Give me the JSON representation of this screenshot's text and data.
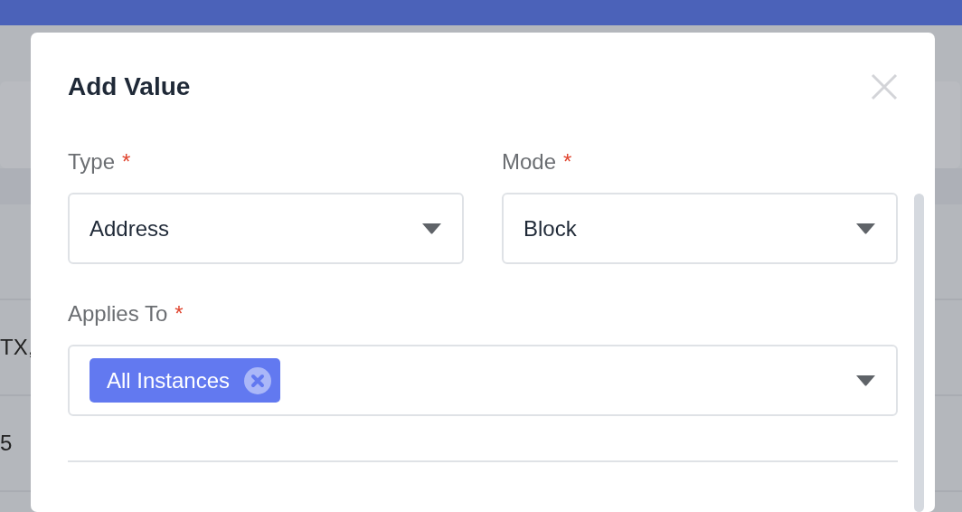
{
  "background": {
    "rows": [
      {
        "text": "TX,"
      },
      {
        "text": "5"
      }
    ]
  },
  "modal": {
    "title": "Add Value",
    "required_mark": "*",
    "fields": [
      {
        "label": "Type",
        "required": true,
        "value": "Address"
      },
      {
        "label": "Mode",
        "required": true,
        "value": "Block"
      }
    ],
    "applies_to": {
      "label": "Applies To",
      "required": true,
      "tags": [
        {
          "label": "All Instances"
        }
      ]
    }
  }
}
